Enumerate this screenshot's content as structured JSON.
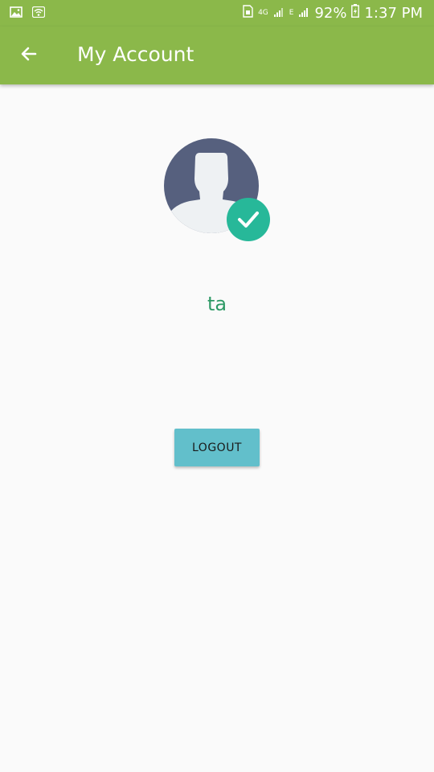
{
  "status_bar": {
    "left_icons": [
      "image-icon",
      "wifi-icon"
    ],
    "network_1": "4G",
    "network_2": "E",
    "battery": "92%",
    "time": "1:37 PM",
    "colors": {
      "bar": "#8bb84a"
    }
  },
  "app_bar": {
    "title": "My Account",
    "back_icon": "arrow-left-icon",
    "color": "#8bb84a"
  },
  "profile": {
    "avatar_icon": "user-silhouette-icon",
    "verified_icon": "check-circle-icon",
    "username": "ta",
    "username_color": "#2e9a66",
    "verified_color": "#27b899"
  },
  "actions": {
    "logout_label": "LOGOUT",
    "logout_color": "#62bfcb"
  }
}
